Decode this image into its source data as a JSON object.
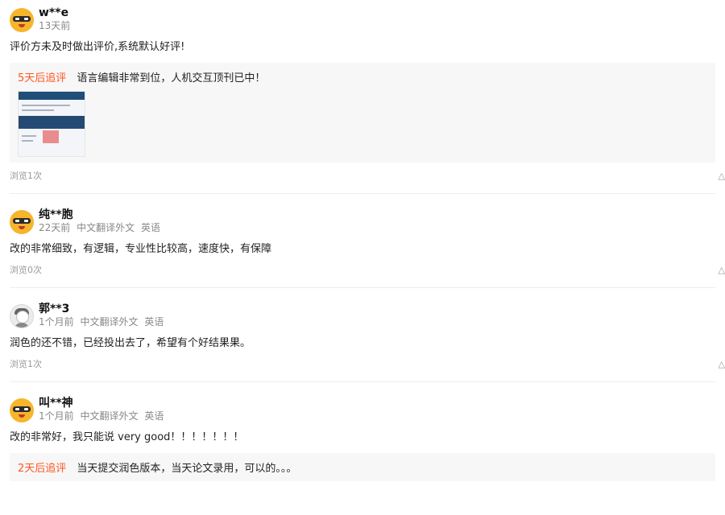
{
  "reviews": [
    {
      "name": "w**e",
      "time": "13天前",
      "service": "",
      "lang": "",
      "text": "评价方未及时做出评价,系统默认好评!",
      "followup": {
        "tag": "5天后追评",
        "text": "语言编辑非常到位，人机交互顶刊已中！"
      },
      "views": "浏览1次",
      "avatar": "bandit-avatar-icon"
    },
    {
      "name": "纯**胞",
      "time": "22天前",
      "service": "中文翻译外文",
      "lang": "英语",
      "text": "改的非常细致，有逻辑，专业性比较高，速度快，有保障",
      "views": "浏览0次",
      "avatar": "bandit-avatar-icon"
    },
    {
      "name": "郭**3",
      "time": "1个月前",
      "service": "中文翻译外文",
      "lang": "英语",
      "text": "润色的还不错，已经投出去了，希望有个好结果果。",
      "views": "浏览1次",
      "avatar": "default-user-avatar-icon"
    },
    {
      "name": "叫**神",
      "time": "1个月前",
      "service": "中文翻译外文",
      "lang": "英语",
      "text": "改的非常好，我只能说 very good！！！！！！！",
      "followup": {
        "tag": "2天后追评",
        "text": "当天提交润色版本，当天论文录用，可以的。。。"
      },
      "avatar": "bandit-avatar-icon"
    }
  ],
  "like_icon": "thumb-up-icon"
}
